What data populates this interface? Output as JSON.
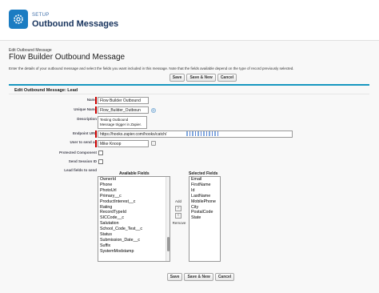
{
  "header": {
    "setup_label": "SETUP",
    "title": "Outbound Messages",
    "icon": "gear-icon"
  },
  "page": {
    "breadcrumb": "Edit Outbound Message",
    "title": "Flow Builder Outbound Message",
    "intro": "Enter the details of your outbound message and select the fields you want included in this message. Note that the fields available depend on the type of record previously selected."
  },
  "buttons": {
    "save": "Save",
    "save_new": "Save & New",
    "cancel": "Cancel"
  },
  "block": {
    "title": "Edit Outbound Message: Lead"
  },
  "form": {
    "name_label": "Name",
    "name_value": "Flow Builder Outbound",
    "unique_name_label": "Unique Name",
    "unique_name_value": "Flow_Builder_Outboun",
    "description_label": "Description",
    "description_line1": "Testing Outbound",
    "description_line2": "Message trigger in Zapier.",
    "endpoint_label": "Endpoint URL",
    "endpoint_value": "https://hooks.zapier.com/hooks/catch/",
    "user_label": "User to send as",
    "user_value": "Mike Knoop",
    "protected_label": "Protected Component",
    "session_label": "Send Session ID",
    "fields_label": "Lead fields to send"
  },
  "available": {
    "title": "Available Fields",
    "items": [
      "OwnerId",
      "Phone",
      "PhotoUrl",
      "Primary__c",
      "ProductInterest__c",
      "Rating",
      "RecordTypeId",
      "SICCode__c",
      "Salutation",
      "School_Code_Test__c",
      "Status",
      "Submission_Date__c",
      "Suffix",
      "SystemModstamp"
    ]
  },
  "mover": {
    "add": "Add",
    "remove": "Remove"
  },
  "selected": {
    "title": "Selected Fields",
    "items": [
      "Email",
      "FirstName",
      "Id",
      "LastName",
      "MobilePhone",
      "City",
      "PostalCode",
      "State"
    ]
  },
  "colors": {
    "accent": "#1797c0",
    "brand_icon": "#1b7cc2",
    "required": "#cc0000"
  }
}
